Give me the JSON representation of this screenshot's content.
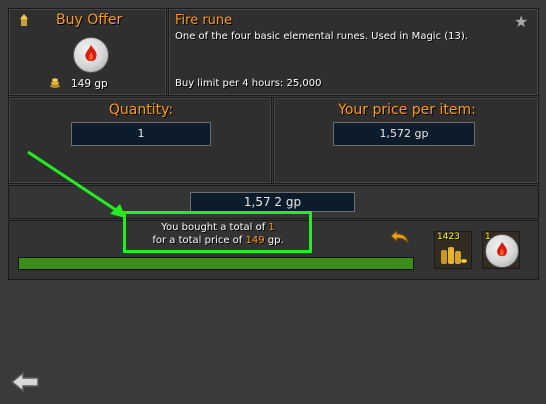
{
  "header": {
    "mode_label": "Buy Offer",
    "price_label": "149 gp"
  },
  "item": {
    "name": "Fire rune",
    "examine": "One of the four basic elemental runes. Used in Magic (13).",
    "buy_limit": "Buy limit per 4 hours: 25,000"
  },
  "quantity": {
    "label": "Quantity:",
    "value": "1"
  },
  "price": {
    "label": "Your price per item:",
    "value": "1,572 gp"
  },
  "total": {
    "value": "1,57 2 gp"
  },
  "status": {
    "line1_prefix": "You bought a total of ",
    "line1_amount": "1",
    "line2_prefix": "for a total price of ",
    "line2_amount": "149",
    "line2_suffix": " gp."
  },
  "progress": {
    "fraction": 1.0,
    "color": "#3c8c1a"
  },
  "collect": {
    "coins_count": "1423",
    "rune_count": "1"
  },
  "icons": {
    "favorite": "star-icon",
    "back": "back-arrow-icon",
    "abort": "undo-arrow-icon",
    "coins": "coins-icon",
    "rune": "fire-rune-icon",
    "offer": "buy-offer-icon"
  },
  "colors": {
    "accent": "#ff981f",
    "highlight": "#22ee22"
  }
}
